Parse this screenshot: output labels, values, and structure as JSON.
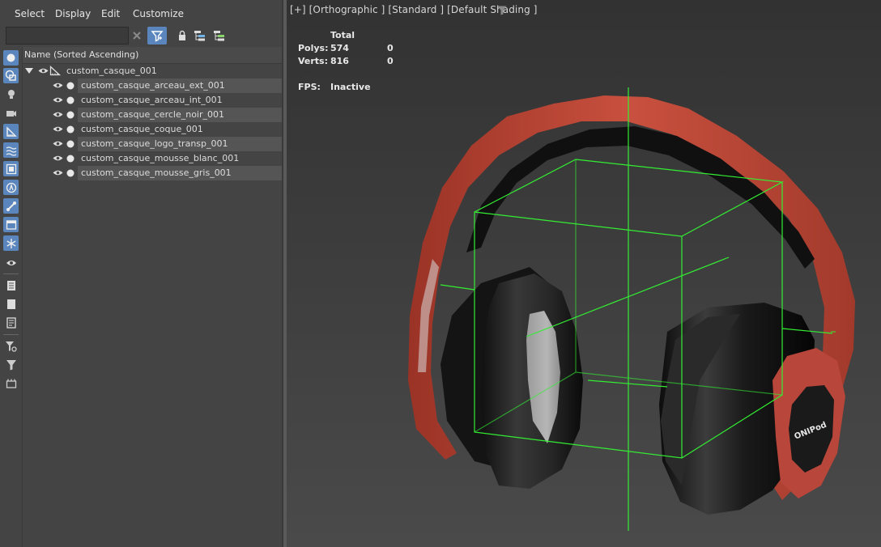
{
  "menu": {
    "select": "Select",
    "display": "Display",
    "edit": "Edit",
    "customize": "Customize"
  },
  "search": {
    "value": "",
    "placeholder": ""
  },
  "tree": {
    "column_header": "Name (Sorted Ascending)",
    "root": "custom_casque_001",
    "children": [
      "custom_casque_arceau_ext_001",
      "custom_casque_arceau_int_001",
      "custom_casque_cercle_noir_001",
      "custom_casque_coque_001",
      "custom_casque_logo_transp_001",
      "custom_casque_mousse_blanc_001",
      "custom_casque_mousse_gris_001"
    ]
  },
  "viewport": {
    "label": "[+] [Orthographic ] [Standard ] [Default Shading ]",
    "stats": {
      "total_header": "Total",
      "polys_label": "Polys:",
      "polys_total": "574",
      "polys_sel": "0",
      "verts_label": "Verts:",
      "verts_total": "816",
      "verts_sel": "0",
      "fps_label": "FPS:",
      "fps_value": "Inactive"
    },
    "logo_text": "ONIPod"
  },
  "colors": {
    "panel_bg": "#444444",
    "accent_blue": "#5b86bd",
    "headband_red": "#c24a3a",
    "bbox_green": "#33ee33"
  },
  "icons": {
    "clear": "close-icon",
    "filter": "filter-icon",
    "lock": "lock-icon",
    "hierarchy": "hierarchy-icon",
    "layers": "layers-icon",
    "visibility": "eye-icon",
    "freeze": "dot-icon"
  }
}
